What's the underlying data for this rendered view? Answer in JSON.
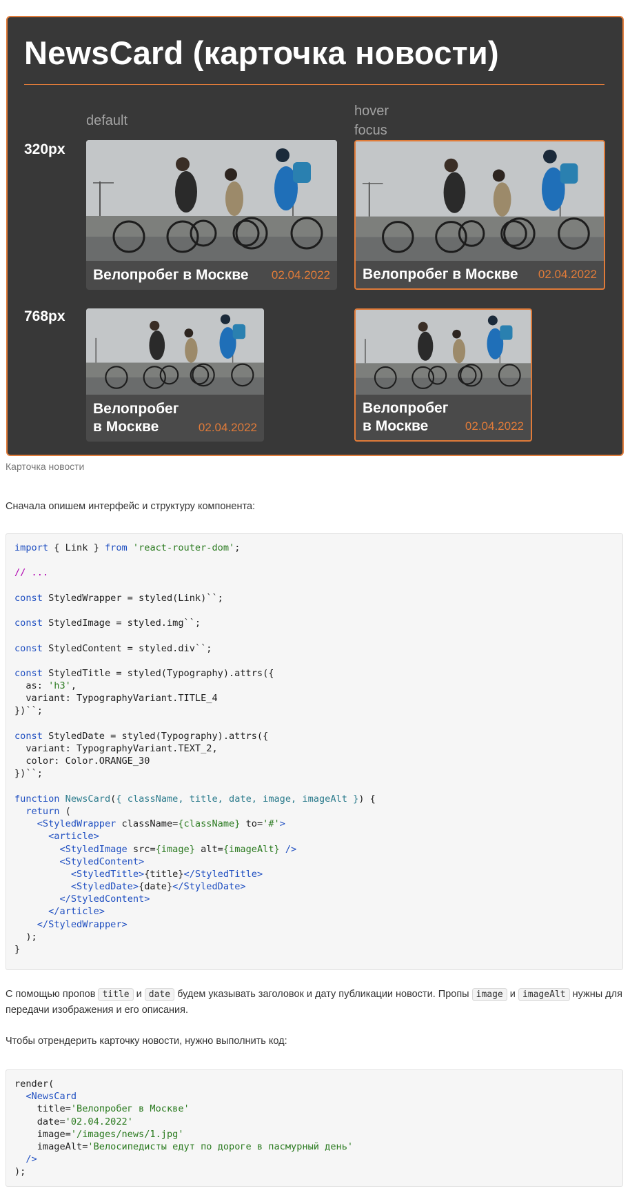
{
  "showcase": {
    "title": "NewsCard (карточка новости)",
    "states": {
      "default": "default",
      "hover": "hover",
      "focus": "focus"
    },
    "breakpoints": [
      "320px",
      "768px"
    ],
    "accent_color": "#e07b39",
    "card": {
      "title": "Велопробег в Москве",
      "title_line1": "Велопробег",
      "title_line2": "в Москве",
      "date": "02.04.2022"
    }
  },
  "caption": "Карточка новости",
  "intro_text": "Сначала опишем интерфейс и структуру компонента:",
  "code_block_1": [
    [
      [
        "kw",
        "import"
      ],
      [
        "plain",
        " { Link } "
      ],
      [
        "kw",
        "from"
      ],
      [
        "plain",
        " "
      ],
      [
        "str",
        "'react-router-dom'"
      ],
      [
        "plain",
        ";"
      ]
    ],
    [],
    [
      [
        "com",
        "// ..."
      ]
    ],
    [],
    [
      [
        "kw",
        "const"
      ],
      [
        "plain",
        " StyledWrapper = styled(Link)``;"
      ]
    ],
    [],
    [
      [
        "kw",
        "const"
      ],
      [
        "plain",
        " StyledImage = styled.img``;"
      ]
    ],
    [],
    [
      [
        "kw",
        "const"
      ],
      [
        "plain",
        " StyledContent = styled.div``;"
      ]
    ],
    [],
    [
      [
        "kw",
        "const"
      ],
      [
        "plain",
        " StyledTitle = styled(Typography).attrs({"
      ]
    ],
    [
      [
        "plain",
        "  as: "
      ],
      [
        "str",
        "'h3'"
      ],
      [
        "plain",
        ","
      ]
    ],
    [
      [
        "plain",
        "  variant: TypographyVariant.TITLE_4"
      ]
    ],
    [
      [
        "plain",
        "})``;"
      ]
    ],
    [],
    [
      [
        "kw",
        "const"
      ],
      [
        "plain",
        " StyledDate = styled(Typography).attrs({"
      ]
    ],
    [
      [
        "plain",
        "  variant: TypographyVariant.TEXT_2,"
      ]
    ],
    [
      [
        "plain",
        "  color: Color.ORANGE_30"
      ]
    ],
    [
      [
        "plain",
        "})``;"
      ]
    ],
    [],
    [
      [
        "kw",
        "function"
      ],
      [
        "plain",
        " "
      ],
      [
        "fn",
        "NewsCard"
      ],
      [
        "plain",
        "("
      ],
      [
        "prm",
        "{ className, title, date, image, imageAlt }"
      ],
      [
        "plain",
        ") {"
      ]
    ],
    [
      [
        "plain",
        "  "
      ],
      [
        "kw",
        "return"
      ],
      [
        "plain",
        " ("
      ]
    ],
    [
      [
        "plain",
        "    "
      ],
      [
        "tag",
        "<StyledWrapper"
      ],
      [
        "plain",
        " className="
      ],
      [
        "str",
        "{className}"
      ],
      [
        "plain",
        " to="
      ],
      [
        "str",
        "'#'"
      ],
      [
        "tag",
        ">"
      ]
    ],
    [
      [
        "plain",
        "      "
      ],
      [
        "tag",
        "<article>"
      ]
    ],
    [
      [
        "plain",
        "        "
      ],
      [
        "tag",
        "<StyledImage"
      ],
      [
        "plain",
        " src="
      ],
      [
        "str",
        "{image}"
      ],
      [
        "plain",
        " alt="
      ],
      [
        "str",
        "{imageAlt}"
      ],
      [
        "plain",
        " "
      ],
      [
        "tag",
        "/>"
      ]
    ],
    [
      [
        "plain",
        "        "
      ],
      [
        "tag",
        "<StyledContent>"
      ]
    ],
    [
      [
        "plain",
        "          "
      ],
      [
        "tag",
        "<StyledTitle>"
      ],
      [
        "plain",
        "{title}"
      ],
      [
        "tag",
        "</StyledTitle>"
      ]
    ],
    [
      [
        "plain",
        "          "
      ],
      [
        "tag",
        "<StyledDate>"
      ],
      [
        "plain",
        "{date}"
      ],
      [
        "tag",
        "</StyledDate>"
      ]
    ],
    [
      [
        "plain",
        "        "
      ],
      [
        "tag",
        "</StyledContent>"
      ]
    ],
    [
      [
        "plain",
        "      "
      ],
      [
        "tag",
        "</article>"
      ]
    ],
    [
      [
        "plain",
        "    "
      ],
      [
        "tag",
        "</StyledWrapper>"
      ]
    ],
    [
      [
        "plain",
        "  );"
      ]
    ],
    [
      [
        "plain",
        "}"
      ]
    ]
  ],
  "props_text": {
    "p1": "С помощью пропов",
    "code_title": "title",
    "and1": "и",
    "code_date": "date",
    "p2": "будем указывать заголовок и дату публикации новости. Пропы",
    "code_image": "image",
    "and2": "и",
    "code_imageAlt": "imageAlt",
    "p3": "нужны для передачи изображения и его описания."
  },
  "render_intro": "Чтобы отрендерить карточку новости, нужно выполнить код:",
  "code_block_2": [
    [
      [
        "plain",
        "render("
      ]
    ],
    [
      [
        "plain",
        "  "
      ],
      [
        "tag",
        "<NewsCard"
      ]
    ],
    [
      [
        "plain",
        "    title="
      ],
      [
        "str",
        "'Велопробег в Москве'"
      ]
    ],
    [
      [
        "plain",
        "    date="
      ],
      [
        "str",
        "'02.04.2022'"
      ]
    ],
    [
      [
        "plain",
        "    image="
      ],
      [
        "str",
        "'/images/news/1.jpg'"
      ]
    ],
    [
      [
        "plain",
        "    imageAlt="
      ],
      [
        "str",
        "'Велосипедисты едут по дороге в пасмурный день'"
      ]
    ],
    [
      [
        "plain",
        "  "
      ],
      [
        "tag",
        "/>"
      ]
    ],
    [
      [
        "plain",
        ");"
      ]
    ]
  ]
}
